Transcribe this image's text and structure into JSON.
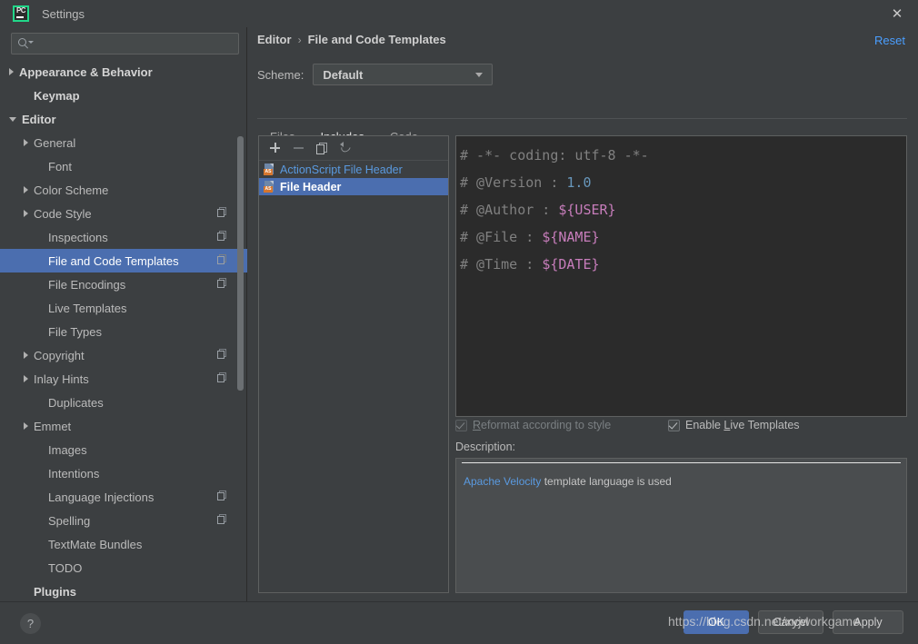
{
  "window": {
    "title": "Settings",
    "app_icon": "pycharm-icon",
    "close_icon": "close-icon"
  },
  "search": {
    "value": "",
    "placeholder": "",
    "icon": "search-icon"
  },
  "sidebar": {
    "items": [
      {
        "label": "Appearance & Behavior",
        "arrow": "collapsed",
        "bold": true,
        "indent": 10,
        "copy": false,
        "selected": false
      },
      {
        "label": "Keymap",
        "arrow": "none",
        "bold": true,
        "indent": 26,
        "copy": false,
        "selected": false
      },
      {
        "label": "Editor",
        "arrow": "expanded",
        "bold": true,
        "indent": 10,
        "copy": false,
        "selected": false
      },
      {
        "label": "General",
        "arrow": "collapsed",
        "bold": false,
        "indent": 26,
        "copy": false,
        "selected": false
      },
      {
        "label": "Font",
        "arrow": "none",
        "bold": false,
        "indent": 42,
        "copy": false,
        "selected": false
      },
      {
        "label": "Color Scheme",
        "arrow": "collapsed",
        "bold": false,
        "indent": 26,
        "copy": false,
        "selected": false
      },
      {
        "label": "Code Style",
        "arrow": "collapsed",
        "bold": false,
        "indent": 26,
        "copy": true,
        "selected": false
      },
      {
        "label": "Inspections",
        "arrow": "none",
        "bold": false,
        "indent": 42,
        "copy": true,
        "selected": false
      },
      {
        "label": "File and Code Templates",
        "arrow": "none",
        "bold": false,
        "indent": 42,
        "copy": true,
        "selected": true
      },
      {
        "label": "File Encodings",
        "arrow": "none",
        "bold": false,
        "indent": 42,
        "copy": true,
        "selected": false
      },
      {
        "label": "Live Templates",
        "arrow": "none",
        "bold": false,
        "indent": 42,
        "copy": false,
        "selected": false
      },
      {
        "label": "File Types",
        "arrow": "none",
        "bold": false,
        "indent": 42,
        "copy": false,
        "selected": false
      },
      {
        "label": "Copyright",
        "arrow": "collapsed",
        "bold": false,
        "indent": 26,
        "copy": true,
        "selected": false
      },
      {
        "label": "Inlay Hints",
        "arrow": "collapsed",
        "bold": false,
        "indent": 26,
        "copy": true,
        "selected": false
      },
      {
        "label": "Duplicates",
        "arrow": "none",
        "bold": false,
        "indent": 42,
        "copy": false,
        "selected": false
      },
      {
        "label": "Emmet",
        "arrow": "collapsed",
        "bold": false,
        "indent": 26,
        "copy": false,
        "selected": false
      },
      {
        "label": "Images",
        "arrow": "none",
        "bold": false,
        "indent": 42,
        "copy": false,
        "selected": false
      },
      {
        "label": "Intentions",
        "arrow": "none",
        "bold": false,
        "indent": 42,
        "copy": false,
        "selected": false
      },
      {
        "label": "Language Injections",
        "arrow": "none",
        "bold": false,
        "indent": 42,
        "copy": true,
        "selected": false
      },
      {
        "label": "Spelling",
        "arrow": "none",
        "bold": false,
        "indent": 42,
        "copy": true,
        "selected": false
      },
      {
        "label": "TextMate Bundles",
        "arrow": "none",
        "bold": false,
        "indent": 42,
        "copy": false,
        "selected": false
      },
      {
        "label": "TODO",
        "arrow": "none",
        "bold": false,
        "indent": 42,
        "copy": false,
        "selected": false
      },
      {
        "label": "Plugins",
        "arrow": "none",
        "bold": true,
        "indent": 26,
        "copy": false,
        "selected": false
      }
    ]
  },
  "header": {
    "breadcrumb": [
      "Editor",
      "File and Code Templates"
    ],
    "separator": "›",
    "reset_label": "Reset",
    "scheme_label": "Scheme:",
    "scheme_value": "Default"
  },
  "tabs": [
    {
      "label": "Files",
      "active": false
    },
    {
      "label": "Includes",
      "active": true
    },
    {
      "label": "Code",
      "active": false
    }
  ],
  "list_toolbar": [
    {
      "icon": "plus-icon",
      "enabled": true
    },
    {
      "icon": "minus-icon",
      "enabled": false
    },
    {
      "icon": "copy-icon",
      "enabled": true
    },
    {
      "icon": "revert-icon",
      "enabled": true
    }
  ],
  "templates": [
    {
      "label": "ActionScript File Header",
      "icon": "actionscript-file-icon",
      "badge": "AS",
      "selected": false
    },
    {
      "label": "File Header",
      "icon": "actionscript-file-icon",
      "badge": "AS",
      "selected": true
    }
  ],
  "editor": {
    "lines": [
      [
        {
          "t": "# -*- coding: utf-8 -*-",
          "c": "comment"
        }
      ],
      [
        {
          "t": "# @Version : ",
          "c": "comment"
        },
        {
          "t": "1.0",
          "c": "number"
        }
      ],
      [
        {
          "t": "# @Author : ",
          "c": "comment"
        },
        {
          "t": "${USER}",
          "c": "variable"
        }
      ],
      [
        {
          "t": "# @File : ",
          "c": "comment"
        },
        {
          "t": "${NAME}",
          "c": "variable"
        }
      ],
      [
        {
          "t": "# @Time : ",
          "c": "comment"
        },
        {
          "t": "${DATE}",
          "c": "variable"
        }
      ]
    ]
  },
  "options": {
    "reformat": {
      "label_before": "",
      "mnemonic": "R",
      "label_after": "eformat according to style",
      "checked": true,
      "disabled": true
    },
    "live_templates": {
      "label_before": "Enable ",
      "mnemonic": "L",
      "label_after": "ive Templates",
      "checked": true,
      "disabled": false
    }
  },
  "description": {
    "label": "Description:",
    "link_text": "Apache Velocity",
    "rest_text": " template language is used"
  },
  "footer": {
    "help_icon": "help-icon",
    "ok_label": "OK",
    "cancel_label": "Cancel",
    "apply_label": "Apply",
    "watermark": "https://blog.csdn.net/xyjworkgame"
  },
  "colors": {
    "background": "#3c3f41",
    "selection": "#4b6eaf",
    "editor_background": "#2b2b2b",
    "link": "#4a9eff",
    "comment": "#808080",
    "number": "#6897bb",
    "variable": "#c77dbb",
    "accent_green": "#21d789"
  }
}
